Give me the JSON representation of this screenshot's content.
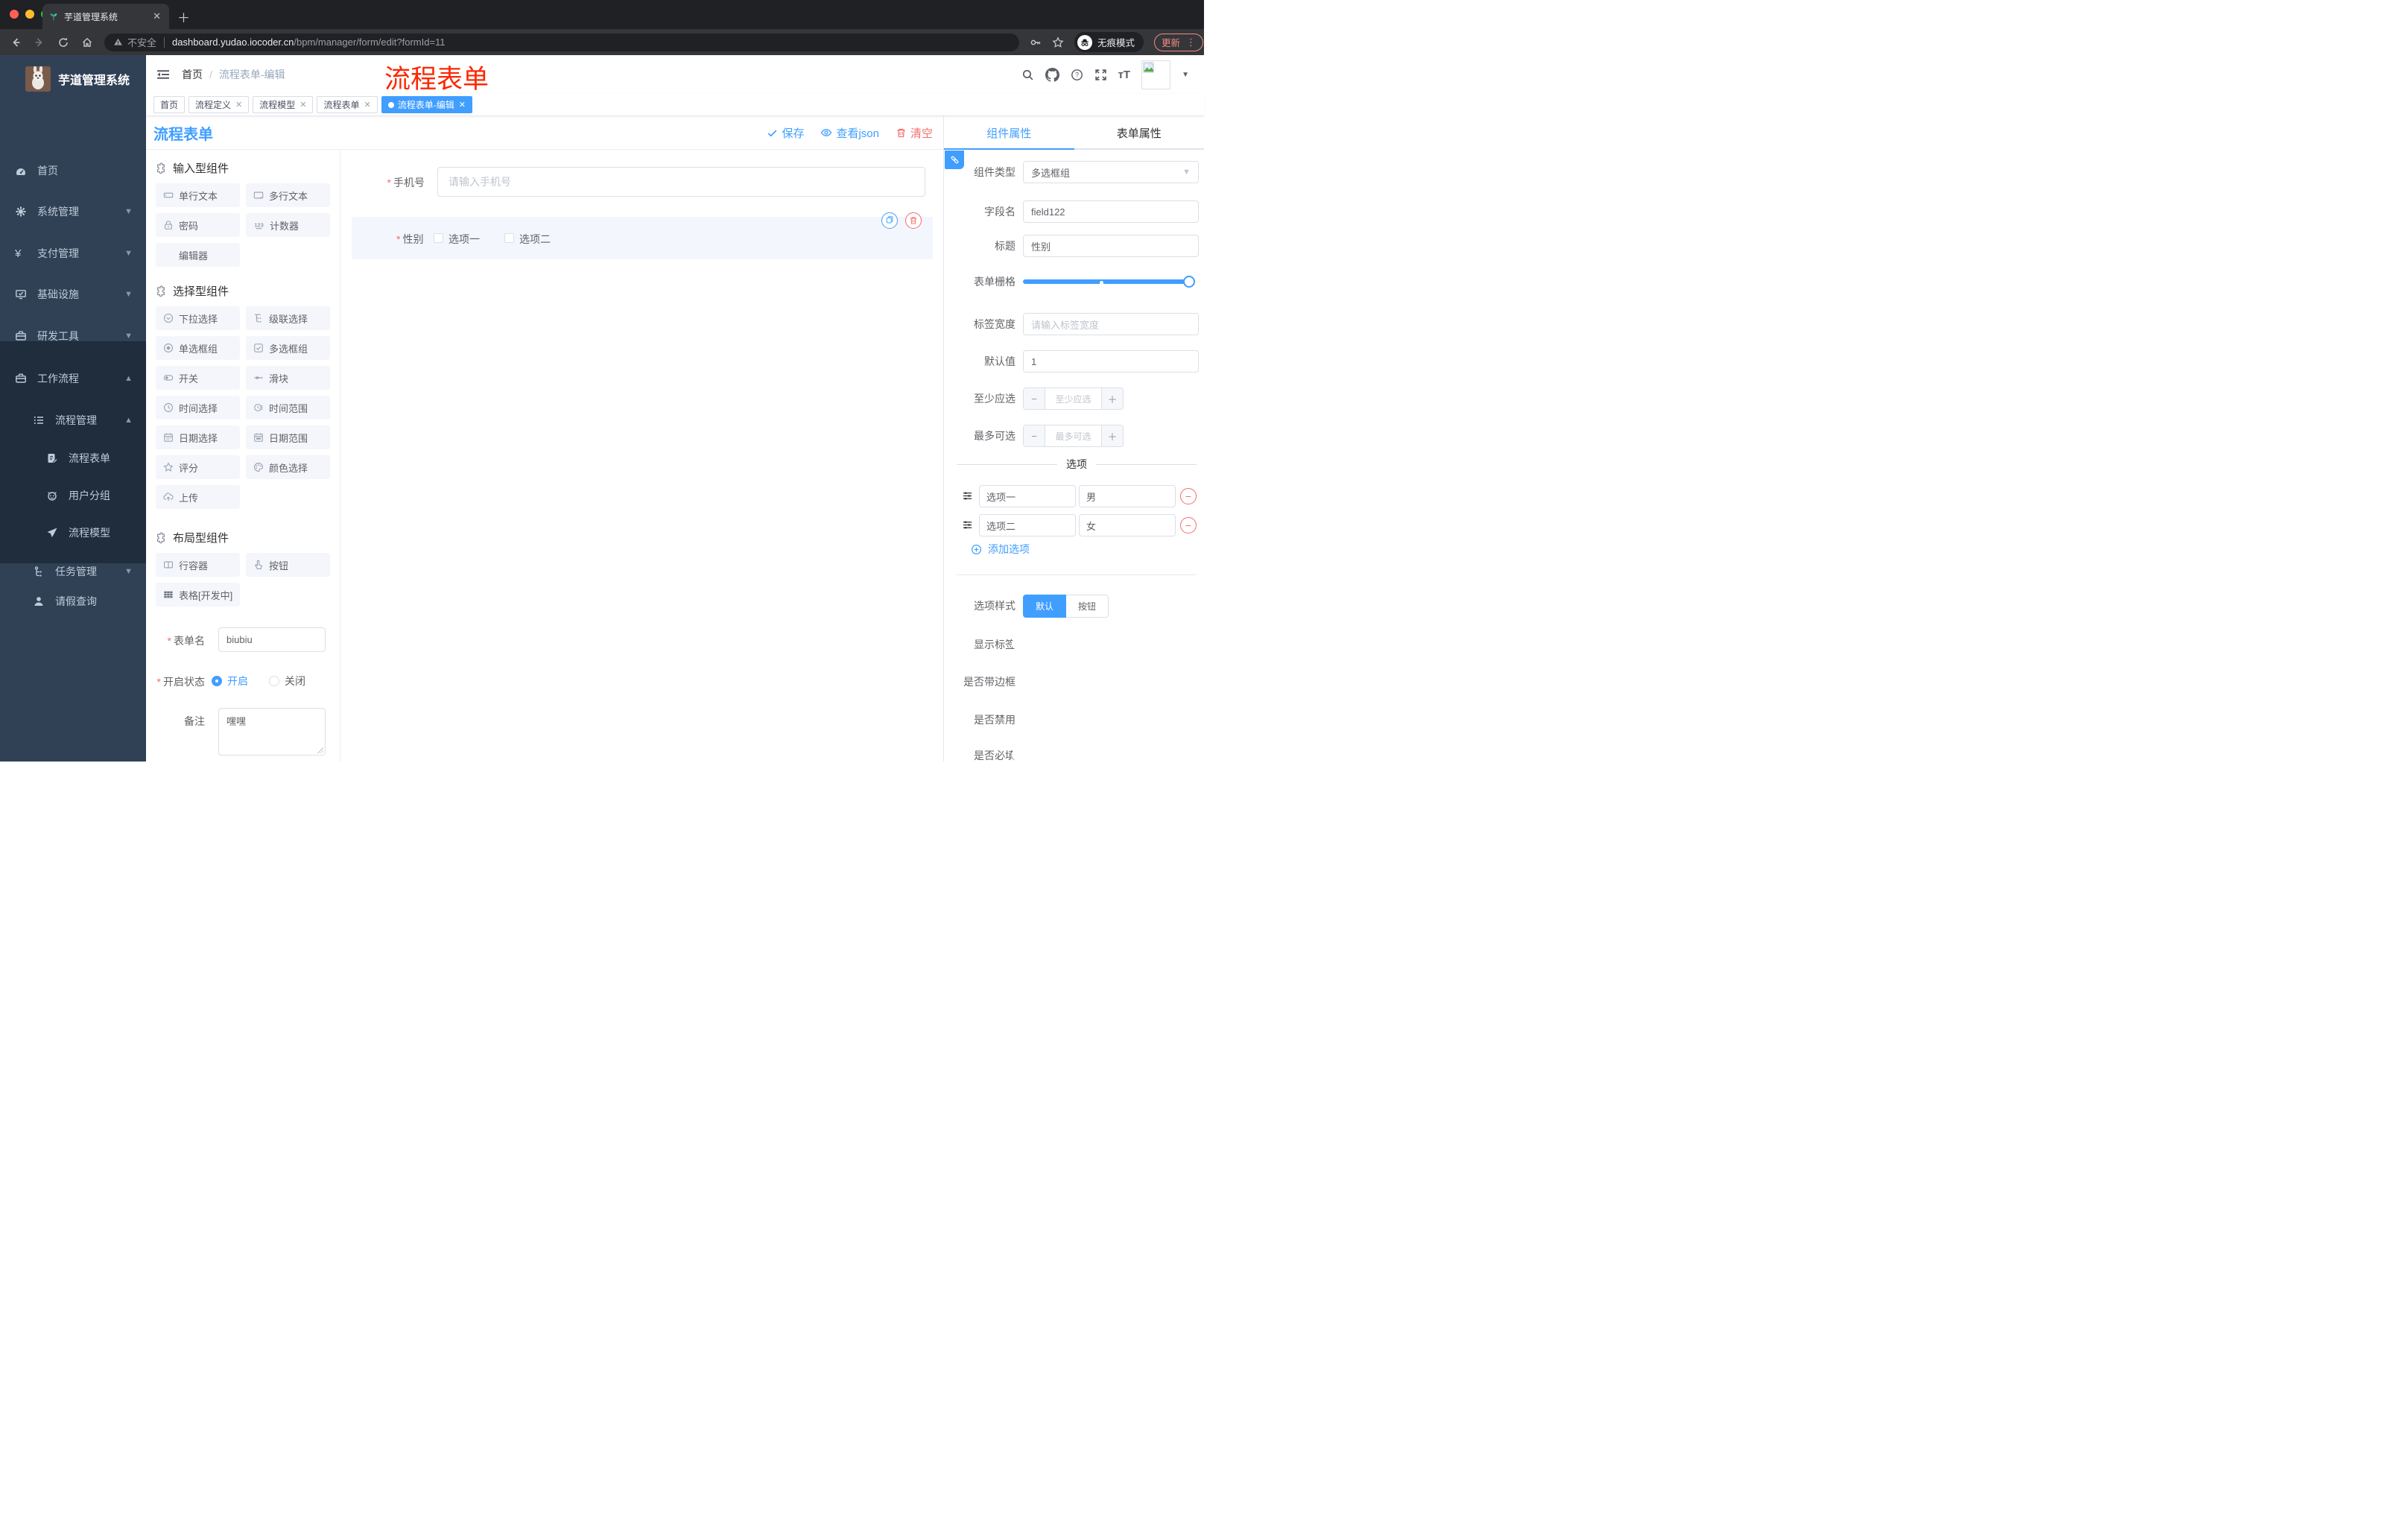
{
  "browser": {
    "tab_title": "芋道管理系统",
    "security": "不安全",
    "url_host": "dashboard.yudao.iocoder.cn",
    "url_path": "/bpm/manager/form/edit?formId=11",
    "incognito": "无痕模式",
    "update": "更新"
  },
  "sidebar": {
    "brand": "芋道管理系统",
    "items": [
      "首页",
      "系统管理",
      "支付管理",
      "基础设施",
      "研发工具",
      "工作流程"
    ],
    "sub": [
      "流程管理",
      "流程表单",
      "用户分组",
      "流程模型",
      "任务管理",
      "请假查询"
    ]
  },
  "header": {
    "breadcrumb": [
      "首页",
      "流程表单-编辑"
    ]
  },
  "annotation": {
    "text": "流程表单",
    "color": "#fb2800"
  },
  "tags": [
    "首页",
    "流程定义",
    "流程模型",
    "流程表单",
    "流程表单-编辑"
  ],
  "toolbar": {
    "title": "流程表单",
    "save": "保存",
    "view_json": "查看json",
    "clear": "清空"
  },
  "palette": {
    "sections": [
      {
        "title": "输入型组件",
        "items": [
          "单行文本",
          "多行文本",
          "密码",
          "计数器",
          "编辑器"
        ]
      },
      {
        "title": "选择型组件",
        "items": [
          "下拉选择",
          "级联选择",
          "单选框组",
          "多选框组",
          "开关",
          "滑块",
          "时间选择",
          "时间范围",
          "日期选择",
          "日期范围",
          "评分",
          "颜色选择",
          "上传"
        ]
      },
      {
        "title": "布局型组件",
        "items": [
          "行容器",
          "按钮",
          "表格[开发中]"
        ]
      }
    ],
    "form": {
      "name_label": "表单名",
      "name_value": "biubiu",
      "status_label": "开启状态",
      "status_on": "开启",
      "status_off": "关闭",
      "remark_label": "备注",
      "remark_value": "嘿嘿"
    }
  },
  "canvas": {
    "phone_label": "手机号",
    "phone_placeholder": "请输入手机号",
    "gender_label": "性别",
    "gender_options": [
      "选项一",
      "选项二"
    ]
  },
  "panel": {
    "tabs": [
      "组件属性",
      "表单属性"
    ],
    "component_type_label": "组件类型",
    "component_type_value": "多选框组",
    "field_name_label": "字段名",
    "field_name_value": "field122",
    "title_label": "标题",
    "title_value": "性别",
    "grid_label": "表单栅格",
    "label_width_label": "标签宽度",
    "label_width_placeholder": "请输入标签宽度",
    "default_label": "默认值",
    "default_value": "1",
    "min_label": "至少应选",
    "min_placeholder": "至少应选",
    "max_label": "最多可选",
    "max_placeholder": "最多可选",
    "options_title": "选项",
    "options": [
      {
        "label": "选项一",
        "value": "男"
      },
      {
        "label": "选项二",
        "value": "女"
      }
    ],
    "add_option": "添加选项",
    "option_style_label": "选项样式",
    "style_default": "默认",
    "style_button": "按钮",
    "show_label_label": "显示标签",
    "border_label": "是否带边框",
    "disabled_label": "是否禁用",
    "required_label": "是否必填"
  },
  "colors": {
    "accent": "#409eff",
    "danger": "#f56c6c",
    "sidebar": "#304156",
    "submenu": "#1f2d3d"
  }
}
